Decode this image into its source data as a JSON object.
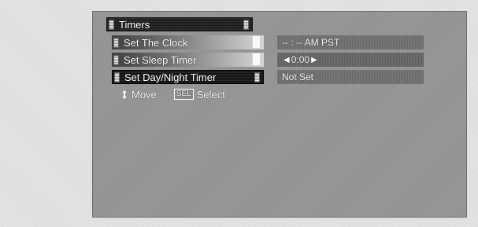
{
  "menu": {
    "title": "Timers",
    "items": [
      {
        "label": "Set The Clock",
        "value": "-- : -- AM PST"
      },
      {
        "label": "Set Sleep Timer",
        "value": "0:00"
      },
      {
        "label": "Set Day/Night Timer",
        "value": "Not Set"
      }
    ]
  },
  "legend": {
    "move_label": "Move",
    "select_key": "SEL",
    "select_label": "Select"
  },
  "icons": {
    "move": "updown-arrow-icon",
    "left_arrow": "left-arrow-icon",
    "right_arrow": "right-arrow-icon"
  }
}
